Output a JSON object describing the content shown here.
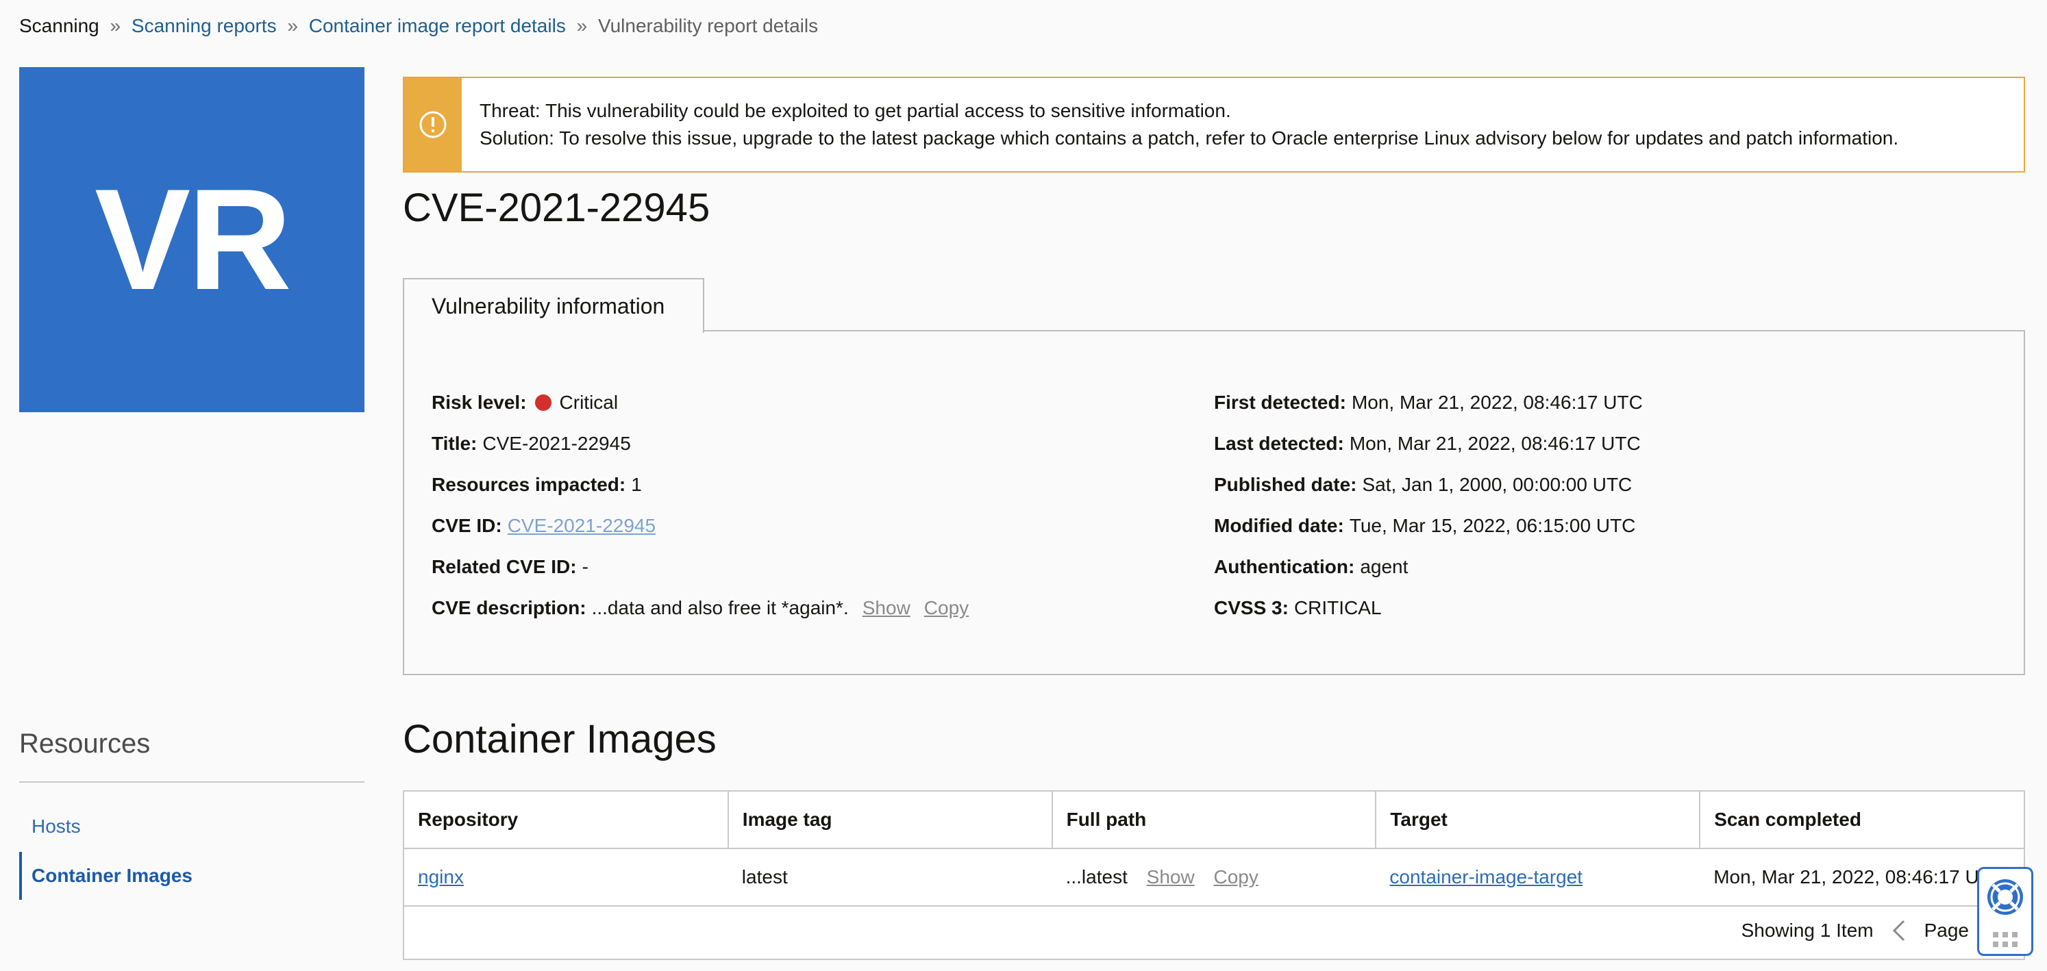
{
  "breadcrumb": {
    "root": "Scanning",
    "sep": "»",
    "item1": "Scanning reports",
    "item2": "Container image report details",
    "current": "Vulnerability report details"
  },
  "avatar": {
    "initials": "VR",
    "color": "#2f6fc6"
  },
  "banner": {
    "threat": "Threat: This vulnerability could be exploited to get partial access to sensitive information.",
    "solution": "Solution: To resolve this issue, upgrade to the latest package which contains a patch, refer to Oracle enterprise Linux advisory below for updates and patch information.",
    "icon": "exclamation-circle-icon",
    "color": "#e9ac40"
  },
  "page_title": "CVE-2021-22945",
  "tab": {
    "label": "Vulnerability information"
  },
  "info": {
    "risk_level_label": "Risk level:",
    "risk_level_value": "Critical",
    "risk_color": "#d32f2f",
    "title_label": "Title:",
    "title_value": "CVE-2021-22945",
    "resources_label": "Resources impacted:",
    "resources_value": "1",
    "cve_id_label": "CVE ID:",
    "cve_id_value": "CVE-2021-22945",
    "related_label": "Related CVE ID:",
    "related_value": "-",
    "desc_label": "CVE description:",
    "desc_value": "...data and also free it *again*.",
    "show_label": "Show",
    "copy_label": "Copy",
    "first_detected_label": "First detected:",
    "first_detected_value": "Mon, Mar 21, 2022, 08:46:17 UTC",
    "last_detected_label": "Last detected:",
    "last_detected_value": "Mon, Mar 21, 2022, 08:46:17 UTC",
    "published_label": "Published date:",
    "published_value": "Sat, Jan 1, 2000, 00:00:00 UTC",
    "modified_label": "Modified date:",
    "modified_value": "Tue, Mar 15, 2022, 06:15:00 UTC",
    "auth_label": "Authentication:",
    "auth_value": "agent",
    "cvss_label": "CVSS 3:",
    "cvss_value": "CRITICAL"
  },
  "resources": {
    "title": "Resources",
    "items": [
      {
        "label": "Hosts"
      },
      {
        "label": "Container Images"
      }
    ]
  },
  "container_images": {
    "title": "Container Images",
    "columns": [
      "Repository",
      "Image tag",
      "Full path",
      "Target",
      "Scan completed"
    ],
    "rows": [
      {
        "repository": "nginx",
        "image_tag": "latest",
        "full_path": "...latest",
        "show_label": "Show",
        "copy_label": "Copy",
        "target": "container-image-target",
        "scan_completed": "Mon, Mar 21, 2022, 08:46:17 U"
      }
    ],
    "footer": {
      "showing": "Showing 1 Item",
      "page_label": "Page"
    }
  },
  "help_widget": {
    "icon": "lifebuoy-icon"
  }
}
